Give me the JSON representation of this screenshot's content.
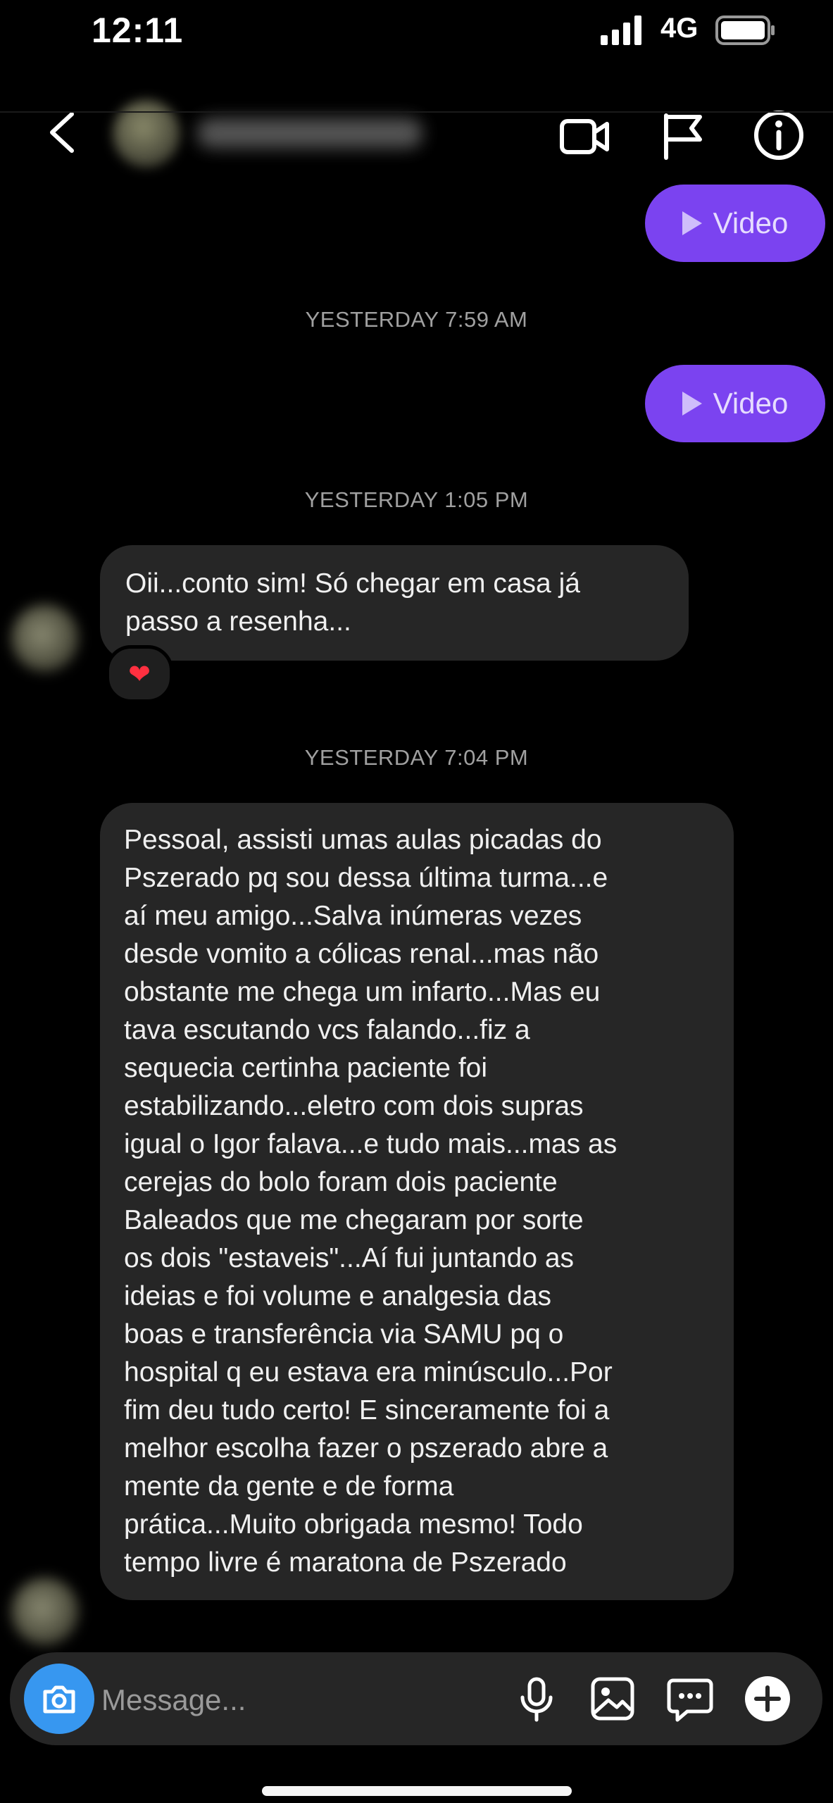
{
  "status_bar": {
    "time": "12:11",
    "network": "4G",
    "icons": [
      "signal-bars-icon",
      "battery-icon"
    ]
  },
  "header": {
    "icons": [
      "back-chevron-icon",
      "video-camera-icon",
      "flag-icon",
      "info-icon"
    ]
  },
  "messages": {
    "video_1": {
      "label": "Video",
      "icon": "play-icon"
    },
    "timestamp_1": "YESTERDAY 7:59 AM",
    "video_2": {
      "label": "Video",
      "icon": "play-icon"
    },
    "timestamp_2": "YESTERDAY 1:05 PM",
    "received_1": "Oii...conto sim! Só chegar em casa já\npasso a resenha...",
    "reaction_1": "❤",
    "timestamp_3": "YESTERDAY 7:04 PM",
    "received_2": "Pessoal, assisti umas aulas picadas do\nPszerado pq sou dessa última turma...e\naí meu amigo...Salva inúmeras vezes\ndesde vomito a cólicas renal...mas não\nobstante me chega um infarto...Mas eu\ntava escutando vcs falando...fiz a\nsequecia certinha paciente foi\nestabilizando...eletro com dois supras\nigual o Igor falava...e tudo mais...mas as\ncerejas do bolo foram dois paciente\nBaleados que me chegaram por sorte\nos dois \"estaveis\"...Aí fui juntando as\nideias e foi volume e analgesia das\nboas e transferência via SAMU pq o\nhospital q eu estava era minúsculo...Por\nfim deu tudo certo! E sinceramente foi a\nmelhor escolha fazer o pszerado abre a\nmente da gente e de forma\nprática...Muito obrigada mesmo! Todo\ntempo livre é maratona de Pszerado"
  },
  "composer": {
    "placeholder": "Message...",
    "icons": [
      "camera-icon",
      "microphone-icon",
      "image-icon",
      "sticker-icon",
      "plus-icon"
    ]
  },
  "colors": {
    "background": "#000000",
    "sent_bubble": "#7b43f0",
    "received_bubble": "#262626",
    "camera_button": "#3797f0",
    "reaction": "#ff3040"
  }
}
